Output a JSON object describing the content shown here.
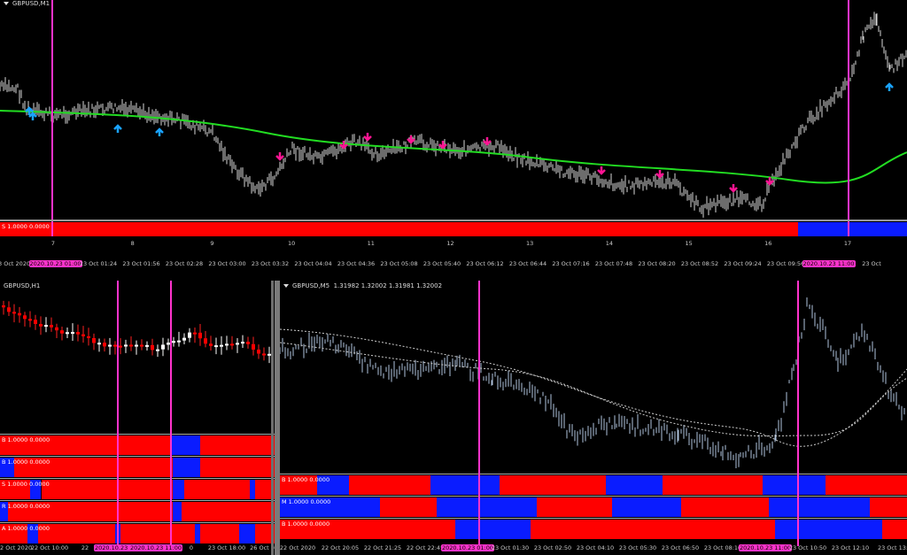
{
  "colors": {
    "red": "#ff0000",
    "blue": "#0a1cff",
    "magenta": "#ff33cc",
    "ma_green": "#22dd22",
    "buy_arrow": "#1aa3ff",
    "sell_arrow": "#ff1493"
  },
  "top_chart": {
    "title": "GBPUSD,M1",
    "indicator_label": "S 1.0000 0.0000",
    "indicator_split_pct": 88,
    "count_labels": [
      "7",
      "8",
      "9",
      "10",
      "11",
      "12",
      "13",
      "14",
      "15",
      "16",
      "17"
    ],
    "time_labels": [
      "23 Oct 2020",
      "2020.10.23 01:00",
      "23 Oct 01:24",
      "23 Oct 01:56",
      "23 Oct 02:28",
      "23 Oct 03:00",
      "23 Oct 03:32",
      "23 Oct 04:04",
      "23 Oct 04:36",
      "23 Oct 05:08",
      "23 Oct 05:40",
      "23 Oct 06:12",
      "23 Oct 06:44",
      "23 Oct 07:16",
      "23 Oct 07:48",
      "23 Oct 08:20",
      "23 Oct 08:52",
      "23 Oct 09:24",
      "23 Oct 09:56",
      "2020.10.23 11:00",
      "23 Oct"
    ]
  },
  "left_chart": {
    "title": "GBPUSD,H1",
    "strips": [
      {
        "label": "B 1.0000 0.0000",
        "segments": [
          [
            "red",
            0,
            62
          ],
          [
            "blue",
            62,
            73
          ],
          [
            "red",
            73,
            100
          ]
        ]
      },
      {
        "label": "B 1.0000 0.0000",
        "segments": [
          [
            "blue",
            0,
            5
          ],
          [
            "red",
            5,
            63
          ],
          [
            "blue",
            63,
            73
          ],
          [
            "red",
            73,
            100
          ]
        ]
      },
      {
        "label": "S 1.0000 0.0000",
        "segments": [
          [
            "red",
            0,
            11
          ],
          [
            "blue",
            11,
            15
          ],
          [
            "red",
            15,
            63
          ],
          [
            "blue",
            63,
            67
          ],
          [
            "red",
            67,
            91
          ],
          [
            "blue",
            91,
            93
          ],
          [
            "red",
            93,
            100
          ]
        ]
      },
      {
        "label": "R 1.0000 0.0000",
        "segments": [
          [
            "blue",
            0,
            3
          ],
          [
            "red",
            3,
            63
          ],
          [
            "blue",
            63,
            66
          ],
          [
            "red",
            66,
            100
          ]
        ]
      },
      {
        "label": "A 1.0000 0.0000",
        "segments": [
          [
            "red",
            0,
            10
          ],
          [
            "blue",
            10,
            14
          ],
          [
            "red",
            14,
            42
          ],
          [
            "blue",
            42,
            44
          ],
          [
            "red",
            44,
            71
          ],
          [
            "blue",
            71,
            73
          ],
          [
            "red",
            73,
            87
          ],
          [
            "blue",
            87,
            93
          ],
          [
            "red",
            93,
            100
          ]
        ]
      }
    ],
    "time_labels": [
      "22 Oct 2020",
      "22 Oct 10:00",
      "22",
      "2020.10.23 01:00",
      "2020.10.23 11:00",
      "0",
      "23 Oct 18:00",
      "26 Oct 0"
    ]
  },
  "right_chart": {
    "title": "GBPUSD,M5",
    "quote": "1.31982 1.32002 1.31981 1.32002",
    "strips": [
      {
        "label": "B 1.0000 0.0000",
        "segments": [
          [
            "red",
            0,
            6
          ],
          [
            "blue",
            6,
            11
          ],
          [
            "red",
            11,
            24
          ],
          [
            "blue",
            24,
            35
          ],
          [
            "red",
            35,
            52
          ],
          [
            "blue",
            52,
            61
          ],
          [
            "red",
            61,
            77
          ],
          [
            "blue",
            77,
            87
          ],
          [
            "red",
            87,
            100
          ]
        ]
      },
      {
        "label": "M 1.0000 0.0000",
        "segments": [
          [
            "blue",
            0,
            16
          ],
          [
            "red",
            16,
            25
          ],
          [
            "blue",
            25,
            41
          ],
          [
            "red",
            41,
            53
          ],
          [
            "blue",
            53,
            64
          ],
          [
            "red",
            64,
            78
          ],
          [
            "blue",
            78,
            94
          ],
          [
            "red",
            94,
            100
          ]
        ]
      },
      {
        "label": "B 1.0000 0.0000",
        "segments": [
          [
            "red",
            0,
            28
          ],
          [
            "blue",
            28,
            40
          ],
          [
            "red",
            40,
            79
          ],
          [
            "blue",
            79,
            96
          ],
          [
            "red",
            96,
            100
          ]
        ]
      }
    ],
    "time_labels": [
      "22 Oct 2020",
      "22 Oct 20:05",
      "22 Oct 21:25",
      "22 Oct 22:45",
      "2020.10.23 01:00",
      "23 Oct 01:30",
      "23 Oct 02:50",
      "23 Oct 04:10",
      "23 Oct 05:30",
      "23 Oct 06:50",
      "23 Oct 08:10",
      "2020.10.23 11:00",
      "23 Oct 10:50",
      "23 Oct 12:10",
      "23 Oct 13:"
    ]
  }
}
